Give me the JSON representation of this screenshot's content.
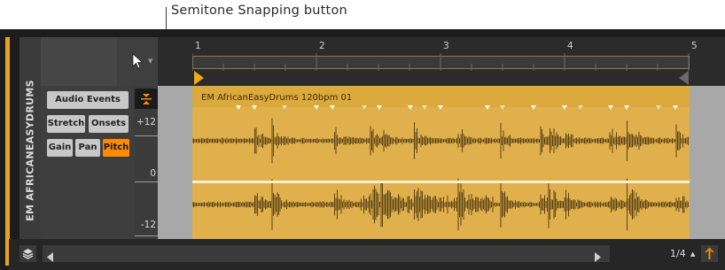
{
  "annotation": {
    "text": "Semitone Snapping button"
  },
  "track": {
    "name": "EM AFRICANEASYDRUMS",
    "accent_color": "#e9a320"
  },
  "inspector": {
    "audio_events_label": "Audio Events",
    "stretch_label": "Stretch",
    "onsets_label": "Onsets",
    "gain_label": "Gain",
    "pan_label": "Pan",
    "pitch_label": "Pitch",
    "pitch_active_color": "#ff8a00"
  },
  "tools": {
    "pointer_icon": "arrow-pointer-icon",
    "snap_icon": "semitone-snap-icon"
  },
  "scale": {
    "top": "+12",
    "middle": "0",
    "bottom": "-12"
  },
  "ruler": {
    "bars": [
      "1",
      "2",
      "3",
      "4",
      "5"
    ]
  },
  "clip": {
    "name": "EM AfricanEasyDrums 120bpm 01",
    "color": "#e0b04c"
  },
  "footer": {
    "grid_value": "1/4"
  }
}
